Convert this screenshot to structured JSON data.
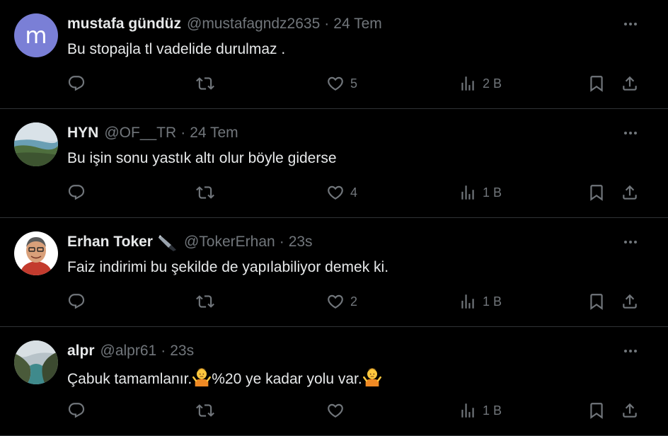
{
  "tweets": [
    {
      "name": "mustafa gündüz",
      "handle": "@mustafagndz2635",
      "time": "24 Tem",
      "avatar_letter": "m",
      "avatar_color": "#7a7fd6",
      "text": "Bu stopajla tl vadelide durulmaz .",
      "likes": "5",
      "views": "2 B"
    },
    {
      "name": "HYN",
      "handle": "@OF__TR",
      "time": "24 Tem",
      "text": "Bu işin sonu yastık altı olur böyle giderse",
      "likes": "4",
      "views": "1 B"
    },
    {
      "name": "Erhan Toker",
      "handle": "@TokerErhan",
      "time": "23s",
      "text": "Faiz indirimi bu şekilde de yapılabiliyor demek ki.",
      "likes": "2",
      "views": "1 B"
    },
    {
      "name": "alpr",
      "handle": "@alpr61",
      "time": "23s",
      "text_a": "Çabuk tamamlanır.",
      "text_b": "%20 ye kadar yolu var.",
      "likes": "",
      "views": "1 B"
    }
  ],
  "icons": {
    "reply": "reply-icon",
    "retweet": "retweet-icon",
    "like": "heart-icon",
    "views": "views-icon",
    "bookmark": "bookmark-icon",
    "share": "share-icon",
    "more": "more-icon",
    "emoji": "person-shrugging-emoji",
    "badge": "fountain-pen-icon"
  },
  "colors": {
    "background": "#000000",
    "text": "#e7e9ea",
    "muted": "#71767b",
    "divider": "#2f3336"
  }
}
